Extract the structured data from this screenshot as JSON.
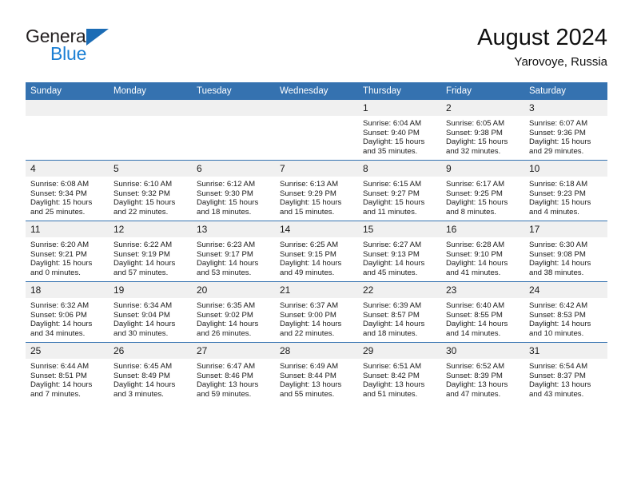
{
  "brand": {
    "name_part1": "General",
    "name_part2": "Blue",
    "triangle_color": "#1b6cb5",
    "blue_color": "#1b7fd4"
  },
  "header": {
    "title": "August 2024",
    "subtitle": "Yarovoye, Russia",
    "accent_color": "#3572b0",
    "daynum_band_color": "#f0f0f0"
  },
  "weekdays": [
    "Sunday",
    "Monday",
    "Tuesday",
    "Wednesday",
    "Thursday",
    "Friday",
    "Saturday"
  ],
  "weeks": [
    [
      {
        "day": "",
        "empty": true,
        "sunrise": "",
        "sunset": "",
        "daylight1": "",
        "daylight2": ""
      },
      {
        "day": "",
        "empty": true,
        "sunrise": "",
        "sunset": "",
        "daylight1": "",
        "daylight2": ""
      },
      {
        "day": "",
        "empty": true,
        "sunrise": "",
        "sunset": "",
        "daylight1": "",
        "daylight2": ""
      },
      {
        "day": "",
        "empty": true,
        "sunrise": "",
        "sunset": "",
        "daylight1": "",
        "daylight2": ""
      },
      {
        "day": "1",
        "empty": false,
        "sunrise": "Sunrise: 6:04 AM",
        "sunset": "Sunset: 9:40 PM",
        "daylight1": "Daylight: 15 hours",
        "daylight2": "and 35 minutes."
      },
      {
        "day": "2",
        "empty": false,
        "sunrise": "Sunrise: 6:05 AM",
        "sunset": "Sunset: 9:38 PM",
        "daylight1": "Daylight: 15 hours",
        "daylight2": "and 32 minutes."
      },
      {
        "day": "3",
        "empty": false,
        "sunrise": "Sunrise: 6:07 AM",
        "sunset": "Sunset: 9:36 PM",
        "daylight1": "Daylight: 15 hours",
        "daylight2": "and 29 minutes."
      }
    ],
    [
      {
        "day": "4",
        "empty": false,
        "sunrise": "Sunrise: 6:08 AM",
        "sunset": "Sunset: 9:34 PM",
        "daylight1": "Daylight: 15 hours",
        "daylight2": "and 25 minutes."
      },
      {
        "day": "5",
        "empty": false,
        "sunrise": "Sunrise: 6:10 AM",
        "sunset": "Sunset: 9:32 PM",
        "daylight1": "Daylight: 15 hours",
        "daylight2": "and 22 minutes."
      },
      {
        "day": "6",
        "empty": false,
        "sunrise": "Sunrise: 6:12 AM",
        "sunset": "Sunset: 9:30 PM",
        "daylight1": "Daylight: 15 hours",
        "daylight2": "and 18 minutes."
      },
      {
        "day": "7",
        "empty": false,
        "sunrise": "Sunrise: 6:13 AM",
        "sunset": "Sunset: 9:29 PM",
        "daylight1": "Daylight: 15 hours",
        "daylight2": "and 15 minutes."
      },
      {
        "day": "8",
        "empty": false,
        "sunrise": "Sunrise: 6:15 AM",
        "sunset": "Sunset: 9:27 PM",
        "daylight1": "Daylight: 15 hours",
        "daylight2": "and 11 minutes."
      },
      {
        "day": "9",
        "empty": false,
        "sunrise": "Sunrise: 6:17 AM",
        "sunset": "Sunset: 9:25 PM",
        "daylight1": "Daylight: 15 hours",
        "daylight2": "and 8 minutes."
      },
      {
        "day": "10",
        "empty": false,
        "sunrise": "Sunrise: 6:18 AM",
        "sunset": "Sunset: 9:23 PM",
        "daylight1": "Daylight: 15 hours",
        "daylight2": "and 4 minutes."
      }
    ],
    [
      {
        "day": "11",
        "empty": false,
        "sunrise": "Sunrise: 6:20 AM",
        "sunset": "Sunset: 9:21 PM",
        "daylight1": "Daylight: 15 hours",
        "daylight2": "and 0 minutes."
      },
      {
        "day": "12",
        "empty": false,
        "sunrise": "Sunrise: 6:22 AM",
        "sunset": "Sunset: 9:19 PM",
        "daylight1": "Daylight: 14 hours",
        "daylight2": "and 57 minutes."
      },
      {
        "day": "13",
        "empty": false,
        "sunrise": "Sunrise: 6:23 AM",
        "sunset": "Sunset: 9:17 PM",
        "daylight1": "Daylight: 14 hours",
        "daylight2": "and 53 minutes."
      },
      {
        "day": "14",
        "empty": false,
        "sunrise": "Sunrise: 6:25 AM",
        "sunset": "Sunset: 9:15 PM",
        "daylight1": "Daylight: 14 hours",
        "daylight2": "and 49 minutes."
      },
      {
        "day": "15",
        "empty": false,
        "sunrise": "Sunrise: 6:27 AM",
        "sunset": "Sunset: 9:13 PM",
        "daylight1": "Daylight: 14 hours",
        "daylight2": "and 45 minutes."
      },
      {
        "day": "16",
        "empty": false,
        "sunrise": "Sunrise: 6:28 AM",
        "sunset": "Sunset: 9:10 PM",
        "daylight1": "Daylight: 14 hours",
        "daylight2": "and 41 minutes."
      },
      {
        "day": "17",
        "empty": false,
        "sunrise": "Sunrise: 6:30 AM",
        "sunset": "Sunset: 9:08 PM",
        "daylight1": "Daylight: 14 hours",
        "daylight2": "and 38 minutes."
      }
    ],
    [
      {
        "day": "18",
        "empty": false,
        "sunrise": "Sunrise: 6:32 AM",
        "sunset": "Sunset: 9:06 PM",
        "daylight1": "Daylight: 14 hours",
        "daylight2": "and 34 minutes."
      },
      {
        "day": "19",
        "empty": false,
        "sunrise": "Sunrise: 6:34 AM",
        "sunset": "Sunset: 9:04 PM",
        "daylight1": "Daylight: 14 hours",
        "daylight2": "and 30 minutes."
      },
      {
        "day": "20",
        "empty": false,
        "sunrise": "Sunrise: 6:35 AM",
        "sunset": "Sunset: 9:02 PM",
        "daylight1": "Daylight: 14 hours",
        "daylight2": "and 26 minutes."
      },
      {
        "day": "21",
        "empty": false,
        "sunrise": "Sunrise: 6:37 AM",
        "sunset": "Sunset: 9:00 PM",
        "daylight1": "Daylight: 14 hours",
        "daylight2": "and 22 minutes."
      },
      {
        "day": "22",
        "empty": false,
        "sunrise": "Sunrise: 6:39 AM",
        "sunset": "Sunset: 8:57 PM",
        "daylight1": "Daylight: 14 hours",
        "daylight2": "and 18 minutes."
      },
      {
        "day": "23",
        "empty": false,
        "sunrise": "Sunrise: 6:40 AM",
        "sunset": "Sunset: 8:55 PM",
        "daylight1": "Daylight: 14 hours",
        "daylight2": "and 14 minutes."
      },
      {
        "day": "24",
        "empty": false,
        "sunrise": "Sunrise: 6:42 AM",
        "sunset": "Sunset: 8:53 PM",
        "daylight1": "Daylight: 14 hours",
        "daylight2": "and 10 minutes."
      }
    ],
    [
      {
        "day": "25",
        "empty": false,
        "sunrise": "Sunrise: 6:44 AM",
        "sunset": "Sunset: 8:51 PM",
        "daylight1": "Daylight: 14 hours",
        "daylight2": "and 7 minutes."
      },
      {
        "day": "26",
        "empty": false,
        "sunrise": "Sunrise: 6:45 AM",
        "sunset": "Sunset: 8:49 PM",
        "daylight1": "Daylight: 14 hours",
        "daylight2": "and 3 minutes."
      },
      {
        "day": "27",
        "empty": false,
        "sunrise": "Sunrise: 6:47 AM",
        "sunset": "Sunset: 8:46 PM",
        "daylight1": "Daylight: 13 hours",
        "daylight2": "and 59 minutes."
      },
      {
        "day": "28",
        "empty": false,
        "sunrise": "Sunrise: 6:49 AM",
        "sunset": "Sunset: 8:44 PM",
        "daylight1": "Daylight: 13 hours",
        "daylight2": "and 55 minutes."
      },
      {
        "day": "29",
        "empty": false,
        "sunrise": "Sunrise: 6:51 AM",
        "sunset": "Sunset: 8:42 PM",
        "daylight1": "Daylight: 13 hours",
        "daylight2": "and 51 minutes."
      },
      {
        "day": "30",
        "empty": false,
        "sunrise": "Sunrise: 6:52 AM",
        "sunset": "Sunset: 8:39 PM",
        "daylight1": "Daylight: 13 hours",
        "daylight2": "and 47 minutes."
      },
      {
        "day": "31",
        "empty": false,
        "sunrise": "Sunrise: 6:54 AM",
        "sunset": "Sunset: 8:37 PM",
        "daylight1": "Daylight: 13 hours",
        "daylight2": "and 43 minutes."
      }
    ]
  ]
}
